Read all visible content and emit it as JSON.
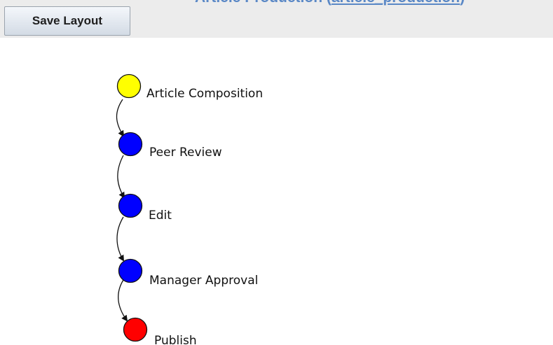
{
  "header": {
    "title_text": "Article Production (",
    "title_link": "article_production",
    "title_close": ")"
  },
  "toolbar": {
    "save_layout_label": "Save Layout"
  },
  "workflow": {
    "nodes": [
      {
        "label": "Article Composition",
        "color": "#ffff00",
        "state": "current"
      },
      {
        "label": "Peer Review",
        "color": "#0000ff",
        "state": "pending"
      },
      {
        "label": "Edit",
        "color": "#0000ff",
        "state": "pending"
      },
      {
        "label": "Manager Approval",
        "color": "#0000ff",
        "state": "pending"
      },
      {
        "label": "Publish",
        "color": "#ff0000",
        "state": "final"
      }
    ]
  }
}
